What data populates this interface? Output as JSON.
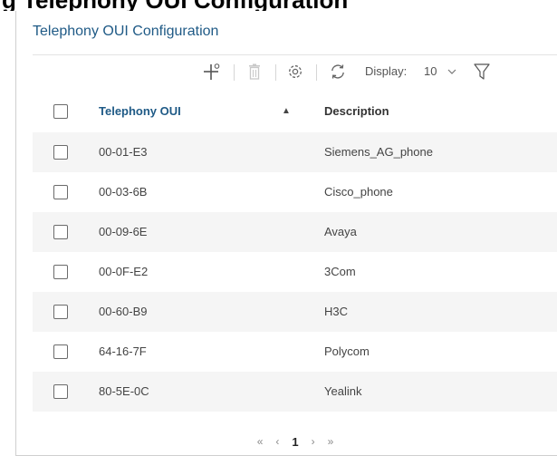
{
  "panel": {
    "title": "Telephony OUI Configuration"
  },
  "toolbar": {
    "display_label": "Display:",
    "display_value": "10",
    "icons": [
      "add-icon",
      "delete-icon",
      "settings-icon",
      "refresh-icon",
      "chevron-down-icon",
      "filter-icon"
    ]
  },
  "table": {
    "headers": {
      "oui": "Telephony OUI",
      "sort_arrow": "▲",
      "description": "Description"
    },
    "rows": [
      {
        "oui": "00-01-E3",
        "description": "Siemens_AG_phone"
      },
      {
        "oui": "00-03-6B",
        "description": "Cisco_phone"
      },
      {
        "oui": "00-09-6E",
        "description": "Avaya"
      },
      {
        "oui": "00-0F-E2",
        "description": "3Com"
      },
      {
        "oui": "00-60-B9",
        "description": "H3C"
      },
      {
        "oui": "64-16-7F",
        "description": "Polycom"
      },
      {
        "oui": "80-5E-0C",
        "description": "Yealink"
      }
    ]
  },
  "pagination": {
    "first": "«",
    "prev": "‹",
    "current": "1",
    "next": "›",
    "last": "»"
  }
}
